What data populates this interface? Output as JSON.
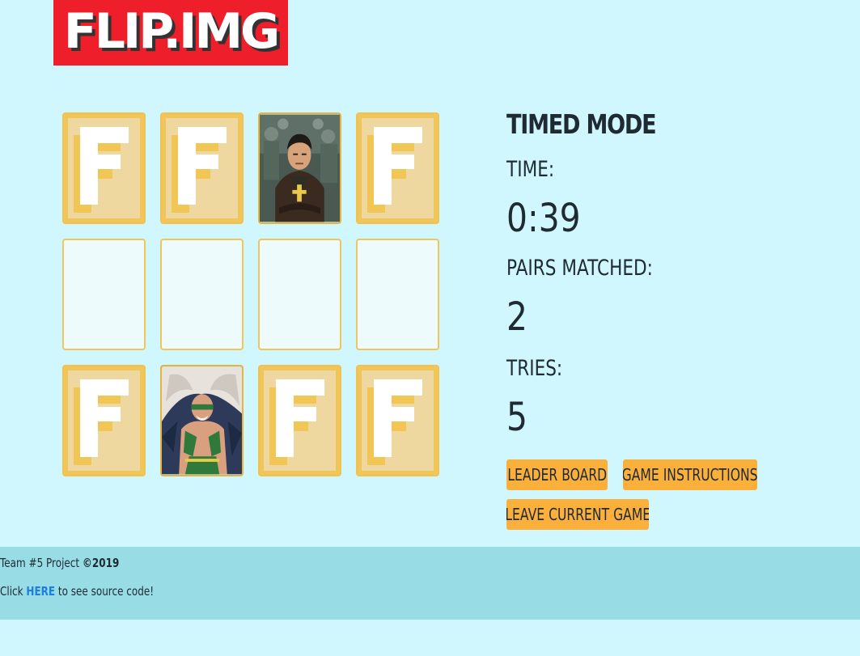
{
  "header": {
    "logo_text": "FLIP.IMG"
  },
  "board": {
    "rows": [
      [
        "back",
        "faceup",
        "back",
        "back"
      ],
      [
        "matched",
        "matched",
        "matched",
        "matched"
      ],
      [
        "back",
        "faceup",
        "back",
        "back"
      ]
    ],
    "card_back_letter": "F"
  },
  "stats": {
    "mode_title": "TIMED MODE",
    "time_label": "TIME:",
    "time_value": "0:39",
    "pairs_label": "PAIRS MATCHED:",
    "pairs_value": "2",
    "tries_label": "TRIES:",
    "tries_value": "5"
  },
  "buttons": {
    "leaderboard": "LEADER BOARD",
    "instructions": "GAME INSTRUCTIONS",
    "leave": "LEAVE CURRENT GAME"
  },
  "footer": {
    "team_text": "Team #5 Project ",
    "copyright": "©2019",
    "click_prefix": "Click ",
    "link_text": "HERE",
    "click_suffix": " to see source code!"
  },
  "colors": {
    "background": "#cff7fd",
    "logo_bg": "#ee1e2b",
    "button": "#fbb03b",
    "footer_bg": "#98dce6",
    "card_back": "#eed8a0",
    "card_border": "#f2c14e"
  }
}
